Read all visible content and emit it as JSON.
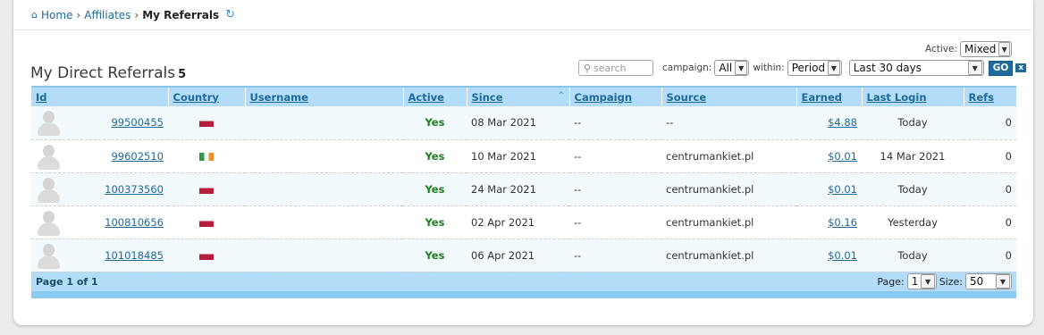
{
  "breadcrumb": {
    "home": "Home",
    "sep1": "›",
    "affiliates": "Affiliates",
    "sep2": "›",
    "current": "My Referrals"
  },
  "heading": {
    "title": "My Direct Referrals",
    "count": "5"
  },
  "filters": {
    "active_label": "Active:",
    "active_value": "Mixed",
    "search_placeholder": "search",
    "campaign_label": "campaign:",
    "campaign_value": "All",
    "within_label": "within:",
    "within_value": "Period",
    "period_value": "Last 30 days",
    "go_label": "GO",
    "clear_label": "x"
  },
  "table": {
    "columns": [
      "Id",
      "Country",
      "Username",
      "Active",
      "Since",
      "Campaign",
      "Source",
      "Earned",
      "Last Login",
      "Refs"
    ],
    "rows": [
      {
        "id": "99500455",
        "country": "pl",
        "username": "",
        "active": "Yes",
        "since": "08 Mar 2021",
        "campaign": "--",
        "source": "--",
        "earned": "$4.88",
        "last_login": "Today",
        "refs": "0"
      },
      {
        "id": "99602510",
        "country": "ie",
        "username": "",
        "active": "Yes",
        "since": "10 Mar 2021",
        "campaign": "--",
        "source": "centrumankiet.pl",
        "earned": "$0.01",
        "last_login": "14 Mar 2021",
        "refs": "0"
      },
      {
        "id": "100373560",
        "country": "pl",
        "username": "",
        "active": "Yes",
        "since": "24 Mar 2021",
        "campaign": "--",
        "source": "centrumankiet.pl",
        "earned": "$0.01",
        "last_login": "Today",
        "refs": "0"
      },
      {
        "id": "100810656",
        "country": "pl",
        "username": "",
        "active": "Yes",
        "since": "02 Apr 2021",
        "campaign": "--",
        "source": "centrumankiet.pl",
        "earned": "$0.16",
        "last_login": "Yesterday",
        "refs": "0"
      },
      {
        "id": "101018485",
        "country": "pl",
        "username": "",
        "active": "Yes",
        "since": "06 Apr 2021",
        "campaign": "--",
        "source": "centrumankiet.pl",
        "earned": "$0.01",
        "last_login": "Today",
        "refs": "0"
      }
    ]
  },
  "pager": {
    "summary": "Page 1 of 1",
    "page_label": "Page:",
    "page_value": "1",
    "size_label": "Size:",
    "size_value": "50"
  },
  "icons": {
    "home": "home-icon",
    "refresh": "refresh-icon",
    "search": "search-icon",
    "sort": "sort-asc-icon",
    "dropdown": "chevron-down-icon"
  },
  "colors": {
    "link": "#1f6a9a",
    "header_bg": "#b3dcf8",
    "active_yes": "#1d7f1d",
    "row_alt": "#f3fafe"
  }
}
